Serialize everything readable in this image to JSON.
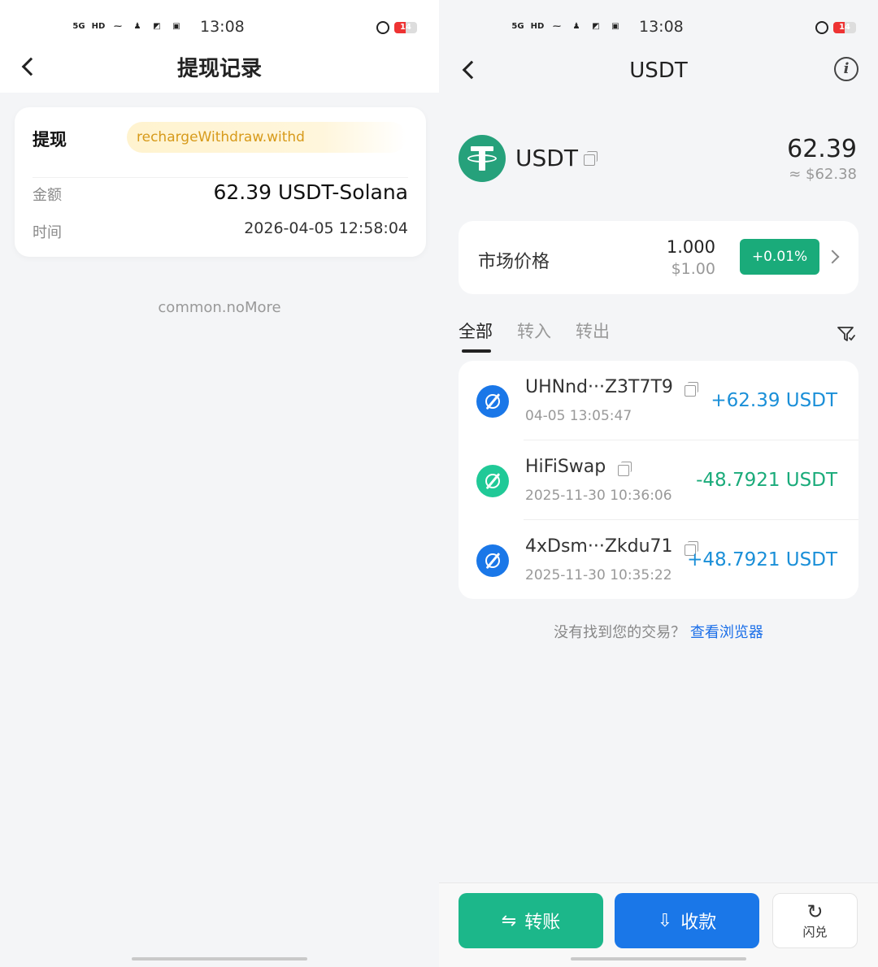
{
  "status_bar": {
    "time": "13:08",
    "left_icons": [
      "5G",
      "HD",
      "⁓",
      "♟",
      "◩",
      "▣"
    ],
    "battery": "14",
    "battery_level": 0.14
  },
  "left": {
    "title": "提现记录",
    "card": {
      "label": "提现",
      "status_text": "rechargeWithdraw.withd",
      "amount_label": "金额",
      "amount_value": "62.39 USDT-Solana",
      "time_label": "时间",
      "time_value": "2026-04-05 12:58:04"
    },
    "no_more": "common.noMore"
  },
  "right": {
    "title": "USDT",
    "coin": {
      "name": "USDT",
      "balance": "62.39",
      "balance_usd": "≈ $62.38"
    },
    "market": {
      "label": "市场价格",
      "price": "1.000",
      "price_usd": "$1.00",
      "change": "+0.01%"
    },
    "tabs": [
      "全部",
      "转入",
      "转出"
    ],
    "transactions": [
      {
        "name": "UHNnd···Z3T7T9",
        "time": "04-05 13:05:47",
        "amount": "+62.39 USDT",
        "type": "in"
      },
      {
        "name": "HiFiSwap",
        "time": "2025-11-30 10:36:06",
        "amount": "-48.7921 USDT",
        "type": "swap"
      },
      {
        "name": "4xDsm···Zkdu71",
        "time": "2025-11-30 10:35:22",
        "amount": "+48.7921 USDT",
        "type": "in"
      }
    ],
    "not_found_text": "没有找到您的交易？",
    "not_found_link": "查看浏览器",
    "buttons": {
      "transfer": "转账",
      "receive": "收款",
      "swap": "闪兑"
    }
  },
  "colors": {
    "green": "#1cb78a",
    "blue": "#1a77e8",
    "incoming_amount": "#1a8fd8",
    "swap_amount": "#1aab7a",
    "highlight_text": "#d79a1a"
  },
  "icons": {
    "back": "chevron-left-icon",
    "info": "info-icon",
    "copy": "copy-icon",
    "filter": "filter-icon",
    "transfer": "transfer-arrows-icon",
    "receive": "download-arrow-icon",
    "swap": "swap-cycle-icon"
  }
}
